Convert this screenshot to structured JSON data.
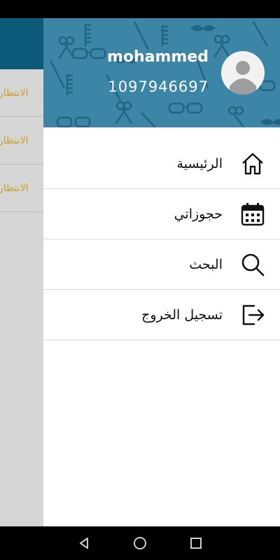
{
  "background_app": {
    "list_items": [
      "الانتظار",
      "الانتظار",
      "الانتظار"
    ]
  },
  "drawer": {
    "user": {
      "name": "mohammed",
      "phone": "1097946697"
    },
    "menu": [
      {
        "label": "الرئيسية",
        "icon": "home-icon"
      },
      {
        "label": "حجوزاتي",
        "icon": "calendar-icon"
      },
      {
        "label": "البحث",
        "icon": "search-icon"
      },
      {
        "label": "تسجيل الخروج",
        "icon": "logout-icon"
      }
    ]
  },
  "colors": {
    "header": "#3b86a6",
    "toolbar": "#0b5a7a",
    "accent_text": "#c9a51a"
  },
  "system_nav": [
    "back-icon",
    "home-circle-icon",
    "recents-icon"
  ]
}
